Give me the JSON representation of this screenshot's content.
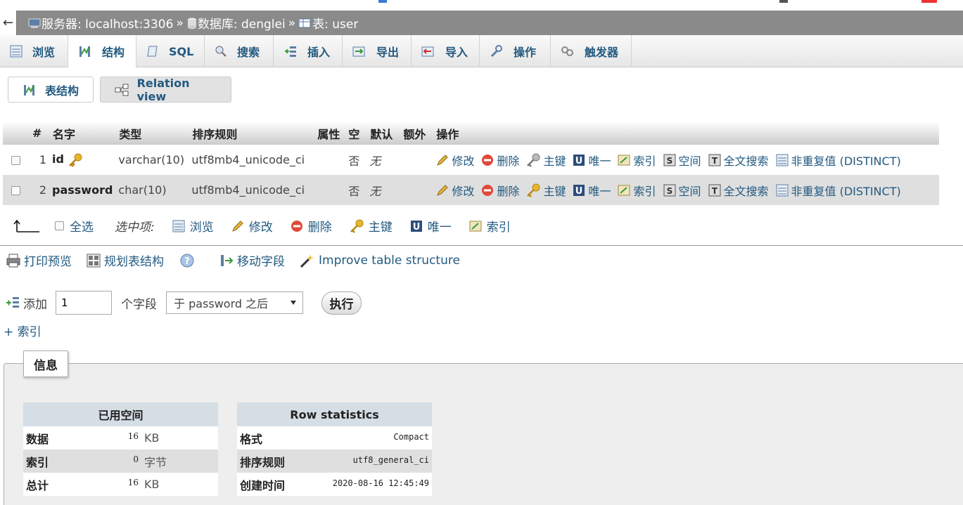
{
  "breadcrumb": {
    "back_glyph": "←",
    "server": "服务器: localhost:3306",
    "database": "数据库: denglei",
    "table": "表: user",
    "separator": "»"
  },
  "tabs": [
    {
      "label": "浏览",
      "icon": "browse-icon"
    },
    {
      "label": "结构",
      "icon": "structure-icon"
    },
    {
      "label": "SQL",
      "icon": "sql-icon"
    },
    {
      "label": "搜索",
      "icon": "search-icon"
    },
    {
      "label": "插入",
      "icon": "insert-icon"
    },
    {
      "label": "导出",
      "icon": "export-icon"
    },
    {
      "label": "导入",
      "icon": "import-icon"
    },
    {
      "label": "操作",
      "icon": "wrench-icon"
    },
    {
      "label": "触发器",
      "icon": "trigger-icon"
    }
  ],
  "subtabs": {
    "table_structure": "表结构",
    "relation_view": "Relation view"
  },
  "columns": {
    "num": "#",
    "name": "名字",
    "type": "类型",
    "collation": "排序规则",
    "attributes": "属性",
    "null": "空",
    "default": "默认",
    "extra": "额外",
    "action": "操作"
  },
  "rows": [
    {
      "num": "1",
      "name": "id",
      "type": "varchar(10)",
      "collation": "utf8mb4_unicode_ci",
      "null": "否",
      "default": "无",
      "primary": true
    },
    {
      "num": "2",
      "name": "password",
      "type": "char(10)",
      "collation": "utf8mb4_unicode_ci",
      "null": "否",
      "default": "无",
      "primary": false
    }
  ],
  "row_actions": {
    "change": "修改",
    "drop": "删除",
    "primary": "主键",
    "unique": "唯一",
    "index": "索引",
    "spatial": "空间",
    "fulltext": "全文搜索",
    "distinct": "非重复值 (DISTINCT)"
  },
  "selection": {
    "check_all": "全选",
    "with_selected": "选中项:",
    "browse": "浏览",
    "change": "修改",
    "drop": "删除",
    "primary": "主键",
    "unique": "唯一",
    "index": "索引"
  },
  "tools": {
    "print": "打印预览",
    "propose": "规划表结构",
    "move_columns": "移动字段",
    "improve": "Improve table structure"
  },
  "add_columns": {
    "label": "添加",
    "count": "1",
    "unit": "个字段",
    "position": "于 password 之后",
    "go": "执行"
  },
  "add_index": "+ 索引",
  "info": {
    "legend": "信息",
    "space_title": "已用空间",
    "space_rows": [
      {
        "key": "数据",
        "value": "16",
        "unit": "KB"
      },
      {
        "key": "索引",
        "value": "0",
        "unit": "字节"
      },
      {
        "key": "总计",
        "value": "16",
        "unit": "KB"
      }
    ],
    "stats_title": "Row statistics",
    "stats_rows": [
      {
        "key": "格式",
        "value": "Compact"
      },
      {
        "key": "排序规则",
        "value": "utf8_general_ci"
      },
      {
        "key": "创建时间",
        "value": "2020-08-16 12:45:49"
      }
    ]
  },
  "colors": {
    "link": "#235a81",
    "breadcrumb_bg": "#8a8a8a",
    "even_row": "#dfdfdf",
    "stats_header": "#d5dde5"
  }
}
